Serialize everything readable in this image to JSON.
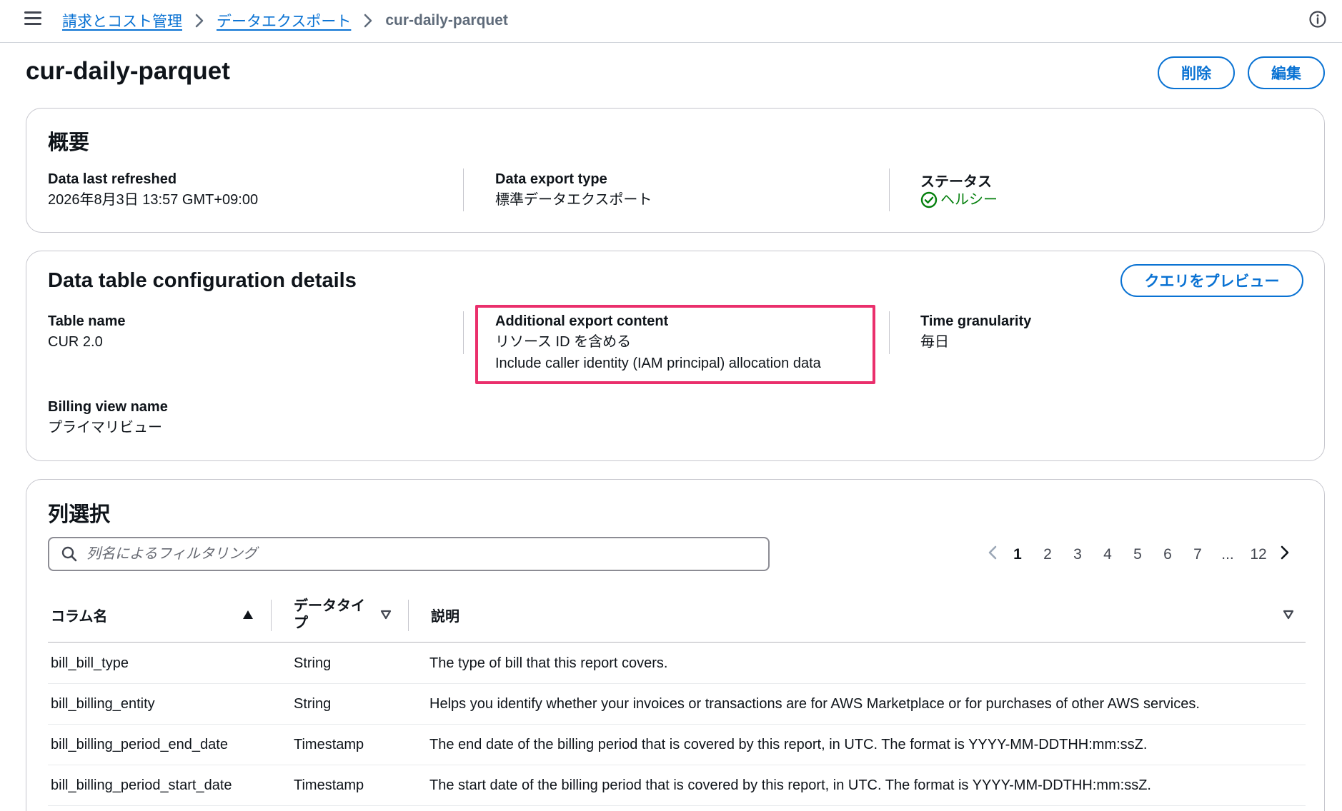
{
  "breadcrumb": {
    "items": [
      "請求とコスト管理",
      "データエクスポート"
    ],
    "current": "cur-daily-parquet"
  },
  "page": {
    "title": "cur-daily-parquet",
    "delete_label": "削除",
    "edit_label": "編集"
  },
  "overview": {
    "title": "概要",
    "fields": [
      {
        "label": "Data last refreshed",
        "value": "2026年8月3日 13:57 GMT+09:00"
      },
      {
        "label": "Data export type",
        "value": "標準データエクスポート"
      },
      {
        "label": "ステータス",
        "value": "ヘルシー"
      }
    ]
  },
  "config": {
    "title": "Data table configuration details",
    "preview_button": "クエリをプレビュー",
    "table_name": {
      "label": "Table name",
      "value": "CUR 2.0"
    },
    "additional": {
      "label": "Additional export content",
      "values": [
        "リソース ID を含める",
        "Include caller identity (IAM principal) allocation data"
      ]
    },
    "granularity": {
      "label": "Time granularity",
      "value": "毎日"
    },
    "billing_view": {
      "label": "Billing view name",
      "value": "プライマリビュー"
    }
  },
  "columns_section": {
    "title": "列選択",
    "search_placeholder": "列名によるフィルタリング",
    "pagination": {
      "pages": [
        "1",
        "2",
        "3",
        "4",
        "5",
        "6",
        "7",
        "...",
        "12"
      ],
      "current": "1"
    },
    "headers": {
      "name": "コラム名",
      "type_line1": "データタイ",
      "type_line2": "プ",
      "description": "説明"
    },
    "rows": [
      {
        "name": "bill_bill_type",
        "type": "String",
        "description": "The type of bill that this report covers."
      },
      {
        "name": "bill_billing_entity",
        "type": "String",
        "description": "Helps you identify whether your invoices or transactions are for AWS Marketplace or for purchases of other AWS services."
      },
      {
        "name": "bill_billing_period_end_date",
        "type": "Timestamp",
        "description": "The end date of the billing period that is covered by this report, in UTC. The format is YYYY-MM-DDTHH:mm:ssZ."
      },
      {
        "name": "bill_billing_period_start_date",
        "type": "Timestamp",
        "description": "The start date of the billing period that is covered by this report, in UTC. The format is YYYY-MM-DDTHH:mm:ssZ."
      }
    ]
  },
  "colors": {
    "link": "#0972d3",
    "success": "#037f0c",
    "highlight": "#ea2f6c"
  },
  "icons": [
    "menu-icon",
    "chevron-right-icon",
    "info-icon",
    "check-circle-icon",
    "search-icon",
    "chevron-left-icon",
    "sort-ascending-icon",
    "sort-descending-icon"
  ]
}
